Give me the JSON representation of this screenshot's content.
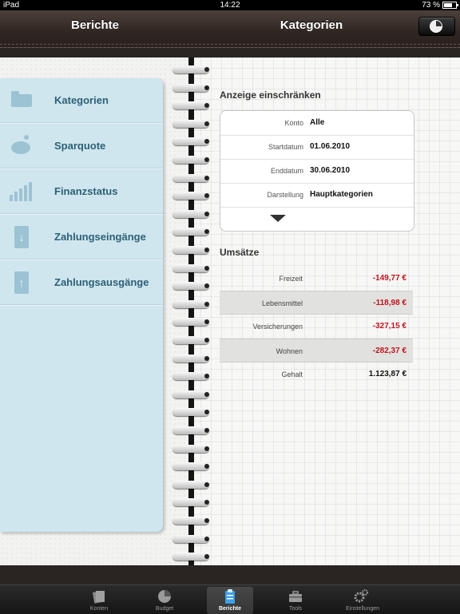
{
  "status_bar": {
    "carrier": "iPad",
    "time": "14:22",
    "battery": "73 %"
  },
  "header": {
    "left_title": "Berichte",
    "right_title": "Kategorien",
    "right_button_icon": "pie-chart-icon"
  },
  "menu": {
    "items": [
      {
        "label": "Kategorien",
        "icon": "folder-icon"
      },
      {
        "label": "Sparquote",
        "icon": "piggy-bank-icon"
      },
      {
        "label": "Finanzstatus",
        "icon": "bar-chart-icon"
      },
      {
        "label": "Zahlungseingänge",
        "icon": "arrow-down-icon"
      },
      {
        "label": "Zahlungsausgänge",
        "icon": "arrow-up-icon"
      }
    ]
  },
  "filter": {
    "title": "Anzeige einschränken",
    "rows": [
      {
        "label": "Konto",
        "value": "Alle"
      },
      {
        "label": "Startdatum",
        "value": "01.06.2010"
      },
      {
        "label": "Enddatum",
        "value": "30.06.2010"
      },
      {
        "label": "Darstellung",
        "value": "Hauptkategorien"
      }
    ],
    "expand_icon": "chevron-down-icon"
  },
  "umsaetze": {
    "title": "Umsätze",
    "rows": [
      {
        "label": "Freizeit",
        "value": "-149,77 €"
      },
      {
        "label": "Lebensmittel",
        "value": "-118,98 €"
      },
      {
        "label": "Versicherungen",
        "value": "-327,15 €"
      },
      {
        "label": "Wohnen",
        "value": "-282,37 €"
      },
      {
        "label": "Gehalt",
        "value": "1.123,87 €"
      }
    ]
  },
  "tabs": [
    {
      "label": "Konten",
      "icon": "accounts-icon"
    },
    {
      "label": "Budget",
      "icon": "pie-chart-icon"
    },
    {
      "label": "Berichte",
      "icon": "clipboard-icon",
      "active": true
    },
    {
      "label": "Tools",
      "icon": "toolbox-icon"
    },
    {
      "label": "Einstellungen",
      "icon": "gears-icon"
    }
  ],
  "colors": {
    "negative": "#c0141c",
    "positive": "#111111",
    "menu_text": "#2d6076",
    "menu_bg": "#cfe6ef"
  }
}
